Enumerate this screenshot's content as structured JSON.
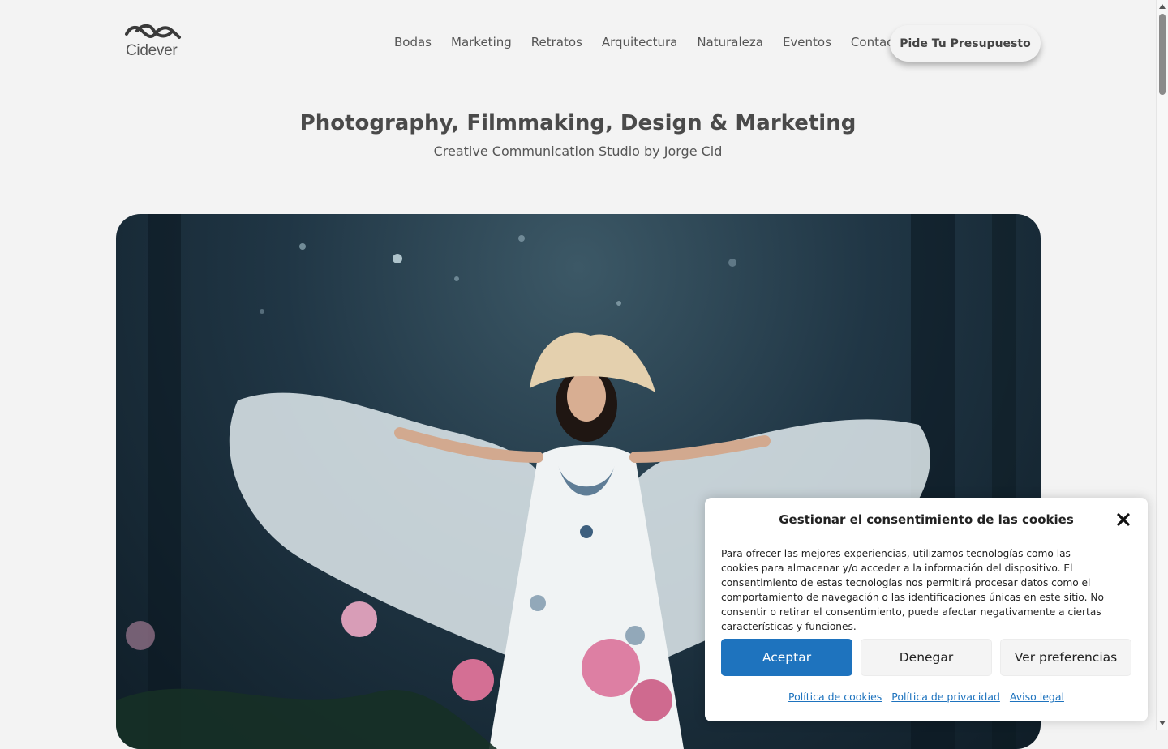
{
  "header": {
    "logo_text": "Cidever",
    "nav": [
      "Bodas",
      "Marketing",
      "Retratos",
      "Arquitectura",
      "Naturaleza",
      "Eventos",
      "Contacto"
    ],
    "cta_label": "Pide Tu Presupuesto"
  },
  "hero": {
    "title": "Photography, Filmmaking, Design & Marketing",
    "subtitle": "Creative Communication Studio by Jorge Cid"
  },
  "cookie": {
    "title": "Gestionar el consentimiento de las cookies",
    "text": "Para ofrecer las mejores experiencias, utilizamos tecnologías como las cookies para almacenar y/o acceder a la información del dispositivo. El consentimiento de estas tecnologías nos permitirá procesar datos como el comportamiento de navegación o las identificaciones únicas en este sitio. No consentir o retirar el consentimiento, puede afectar negativamente a ciertas características y funciones.",
    "accept": "Aceptar",
    "deny": "Denegar",
    "preferences": "Ver preferencias",
    "links": [
      "Política de cookies",
      "Política de privacidad",
      "Aviso legal"
    ]
  },
  "colors": {
    "accent": "#1e73be",
    "background": "#f3f3f3",
    "text": "#444444"
  }
}
